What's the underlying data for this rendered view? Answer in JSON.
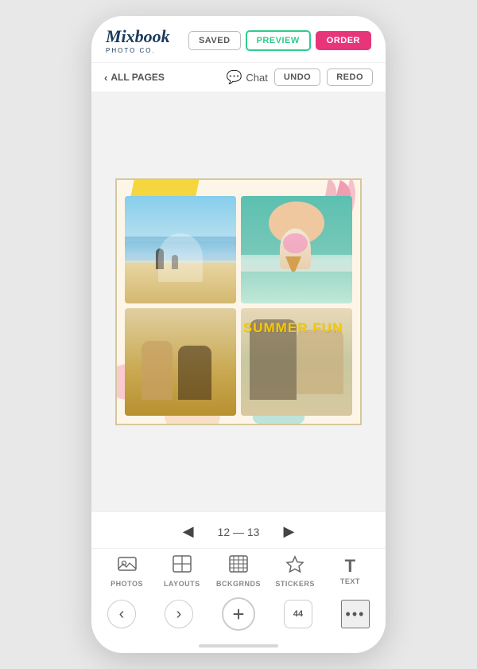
{
  "header": {
    "logo": "Mixbook",
    "logo_sub": "PHOTO CO.",
    "btn_saved": "SAVED",
    "btn_preview": "PREVIEW",
    "btn_order": "ORDER"
  },
  "nav": {
    "all_pages": "ALL PAGES",
    "chat": "Chat",
    "btn_undo": "UNDO",
    "btn_redo": "REDO"
  },
  "canvas": {
    "summer_fun_text": "SUMMER FUN"
  },
  "pagination": {
    "prev_arrow": "◀",
    "next_arrow": "▶",
    "page_range": "12 — 13"
  },
  "toolbar": {
    "items": [
      {
        "id": "photos",
        "label": "PHOTOS",
        "icon": "🖼"
      },
      {
        "id": "layouts",
        "label": "LAYOUTS",
        "icon": "⊞"
      },
      {
        "id": "backgrounds",
        "label": "BCKGRNDS",
        "icon": "▦"
      },
      {
        "id": "stickers",
        "label": "STICKERS",
        "icon": "☆"
      },
      {
        "id": "text",
        "label": "TEXT",
        "icon": "T"
      }
    ]
  },
  "action_bar": {
    "back_label": "‹",
    "forward_label": "›",
    "add_label": "+",
    "pages_count": "44",
    "more_label": "•••"
  },
  "colors": {
    "order_btn": "#e8357a",
    "preview_border": "#2ecc8e",
    "summer_fun": "#f5c800",
    "accent_yellow": "#f5d020",
    "accent_pink": "#e87fa0",
    "accent_mint": "#b2e8d8",
    "accent_teal": "#6ecfc8"
  }
}
